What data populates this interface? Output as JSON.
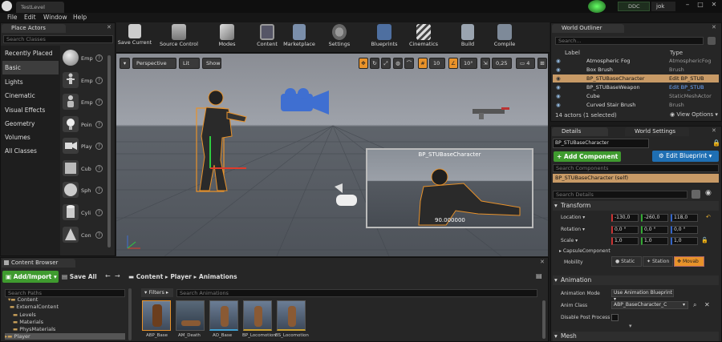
{
  "titlebar": {
    "tab": "TestLevel",
    "ddc": "DDC",
    "user": "jok"
  },
  "menu": [
    "File",
    "Edit",
    "Window",
    "Help"
  ],
  "place_actors": {
    "tab": "Place Actors",
    "search_placeholder": "Search Classes",
    "categories": [
      "Recently Placed",
      "Basic",
      "Lights",
      "Cinematic",
      "Visual Effects",
      "Geometry",
      "Volumes",
      "All Classes"
    ],
    "selected_category": "Basic",
    "items": [
      "Emp",
      "Emp",
      "Emp",
      "Poin",
      "Play",
      "Cub",
      "Sph",
      "Cyli",
      "Con"
    ]
  },
  "toolbar": [
    "Save Current",
    "Source Control",
    "Modes",
    "Content",
    "Marketplace",
    "Settings",
    "Blueprints",
    "Cinematics",
    "Build",
    "Compile"
  ],
  "viewport": {
    "perspective": "Perspective",
    "lit": "Lit",
    "show": "Show",
    "grid_snap": "10",
    "rot_snap": "10°",
    "scale_snap": "0,25",
    "cam_speed": "4",
    "preview_title": "BP_STUBaseCharacter",
    "preview_value": "90.000000"
  },
  "outliner": {
    "tab": "World Outliner",
    "search_placeholder": "Search...",
    "col_label": "Label",
    "col_type": "Type",
    "rows": [
      {
        "label": "Atmospheric Fog",
        "type": "AtmosphericFog"
      },
      {
        "label": "Box Brush",
        "type": "Brush"
      },
      {
        "label": "BP_STUBaseCharacter",
        "type": "Edit BP_STUB"
      },
      {
        "label": "BP_STUBaseWeapon",
        "type": "Edit BP_STUB"
      },
      {
        "label": "Cube",
        "type": "StaticMeshActor"
      },
      {
        "label": "Curved Stair Brush",
        "type": "Brush"
      }
    ],
    "selected_index": 2,
    "status": "14 actors (1 selected)",
    "view_options": "View Options"
  },
  "details": {
    "tab": "Details",
    "tab2": "World Settings",
    "name": "BP_STUBaseCharacter",
    "add_component": "+ Add Component",
    "edit_blueprint": "Edit Blueprint",
    "search_components": "Search Components",
    "component_self": "BP_STUBaseCharacter (self)",
    "search_details": "Search Details",
    "transform": "Transform",
    "location_label": "Location",
    "location": [
      "-130,0",
      "-260,0",
      "118,0"
    ],
    "rotation_label": "Rotation",
    "rotation": [
      "0,0 °",
      "0,0 °",
      "0,0 °"
    ],
    "scale_label": "Scale",
    "scale": [
      "1,0",
      "1,0",
      "1,0"
    ],
    "capsule": "CapsuleComponent",
    "mobility_label": "Mobility",
    "mobility": [
      "Static",
      "Station",
      "Movab"
    ],
    "animation": "Animation",
    "anim_mode_label": "Animation Mode",
    "anim_mode": "Use Animation Blueprint",
    "anim_class_label": "Anim Class",
    "anim_class": "ABP_BaseCharacter_C",
    "disable_post": "Disable Post Process I",
    "mesh": "Mesh"
  },
  "content_browser": {
    "tab": "Content Browser",
    "add_import": "Add/Import",
    "save_all": "Save All",
    "path": [
      "Content",
      "Player",
      "Animations"
    ],
    "search_paths": "Search Paths",
    "filters": "Filters",
    "search_assets": "Search Animations",
    "tree": [
      "Content",
      "ExternalContent",
      "Levels",
      "Materials",
      "PhysMaterials",
      "Player"
    ],
    "assets": [
      "ABP_Base",
      "AM_Death",
      "AO_Base",
      "BP_Locomotion",
      "BS_Locomotion"
    ]
  },
  "colors": {
    "accent_orange": "#e8922a",
    "add_green": "#3f9b2f",
    "blueprint_blue": "#1f6fb3",
    "selected_row": "#c89a66"
  }
}
